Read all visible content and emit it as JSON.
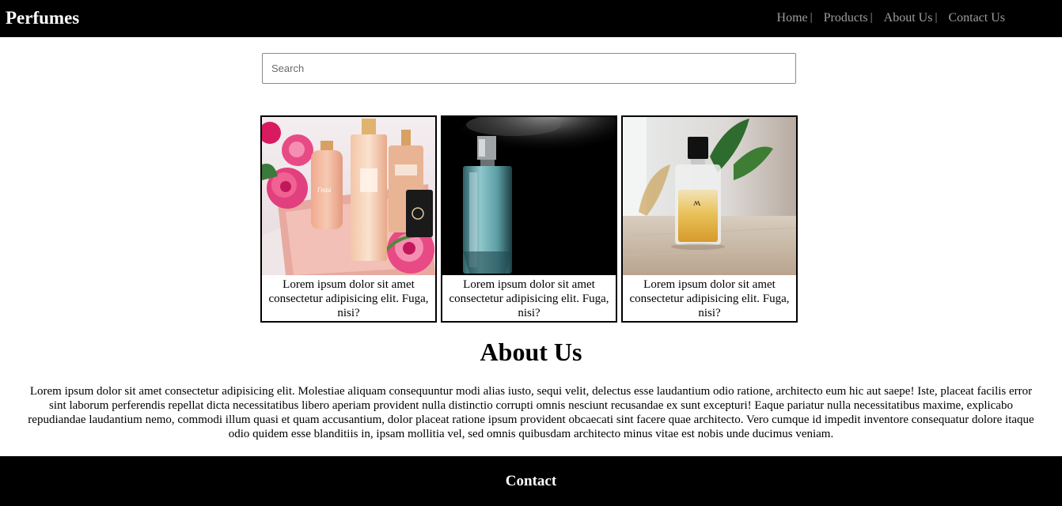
{
  "navbar": {
    "brand": "Perfumes",
    "links": [
      {
        "label": "Home",
        "sep": "|"
      },
      {
        "label": "Products",
        "sep": "|"
      },
      {
        "label": "About Us",
        "sep": "|"
      },
      {
        "label": "Contact Us"
      }
    ]
  },
  "search": {
    "placeholder": "Search"
  },
  "products": [
    {
      "caption": "Lorem ipsum dolor sit amet consectetur adipisicing elit. Fuga, nisi?"
    },
    {
      "caption": "Lorem ipsum dolor sit amet consectetur adipisicing elit. Fuga, nisi?"
    },
    {
      "caption": "Lorem ipsum dolor sit amet consectetur adipisicing elit. Fuga, nisi?"
    }
  ],
  "about": {
    "title": "About Us",
    "body": "Lorem ipsum dolor sit amet consectetur adipisicing elit. Molestiae aliquam consequuntur modi alias iusto, sequi velit, delectus esse laudantium odio ratione, architecto eum hic aut saepe! Iste, placeat facilis error sint laborum perferendis repellat dicta necessitatibus libero aperiam provident nulla distinctio corrupti omnis nesciunt recusandae ex sunt excepturi! Eaque pariatur nulla necessitatibus maxime, explicabo repudiandae laudantium nemo, commodi illum quasi et quam accusantium, dolor placeat ratione ipsum provident obcaecati sint facere quae architecto. Vero cumque id impedit inventore consequatur dolore itaque odio quidem esse blanditiis in, ipsam mollitia vel, sed omnis quibusdam architecto minus vitae est nobis unde ducimus veniam."
  },
  "footer": {
    "title": "Contact"
  }
}
